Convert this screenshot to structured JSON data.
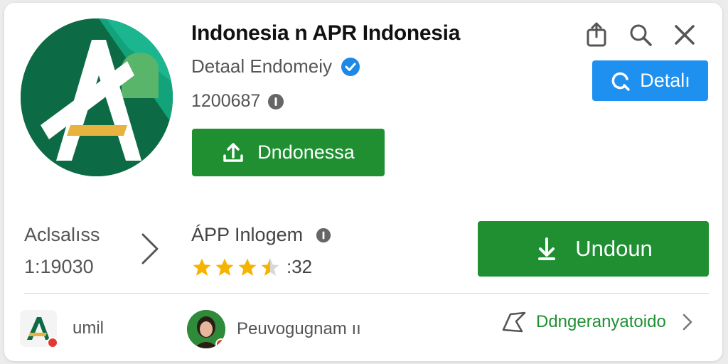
{
  "app": {
    "title": "Indonesia n APR Indonesia",
    "developer": "Detaal Endomeiy",
    "count": "1200687",
    "install_label": "Dndonessa"
  },
  "top_bar": {
    "icons": [
      "share-icon",
      "search-icon",
      "close-icon"
    ],
    "detail_label": "Detalı"
  },
  "stats": {
    "label": "Aclsalıss",
    "value": "1:19030"
  },
  "listing": {
    "name": "ÁPP Inlogem",
    "rating": 3.5,
    "rating_text": ":32",
    "download_label": "Undoun"
  },
  "bottom": {
    "item1_text": "umil",
    "item2_text": "Peuvogugnam ıı",
    "item3_link": "Ddngeranyatoido"
  },
  "colors": {
    "primary_green": "#1f8f32",
    "accent_blue": "#1e90f0",
    "icon_dark_green": "#0c6b45",
    "verified_blue": "#1e88e5",
    "star_yellow": "#f5b400"
  }
}
